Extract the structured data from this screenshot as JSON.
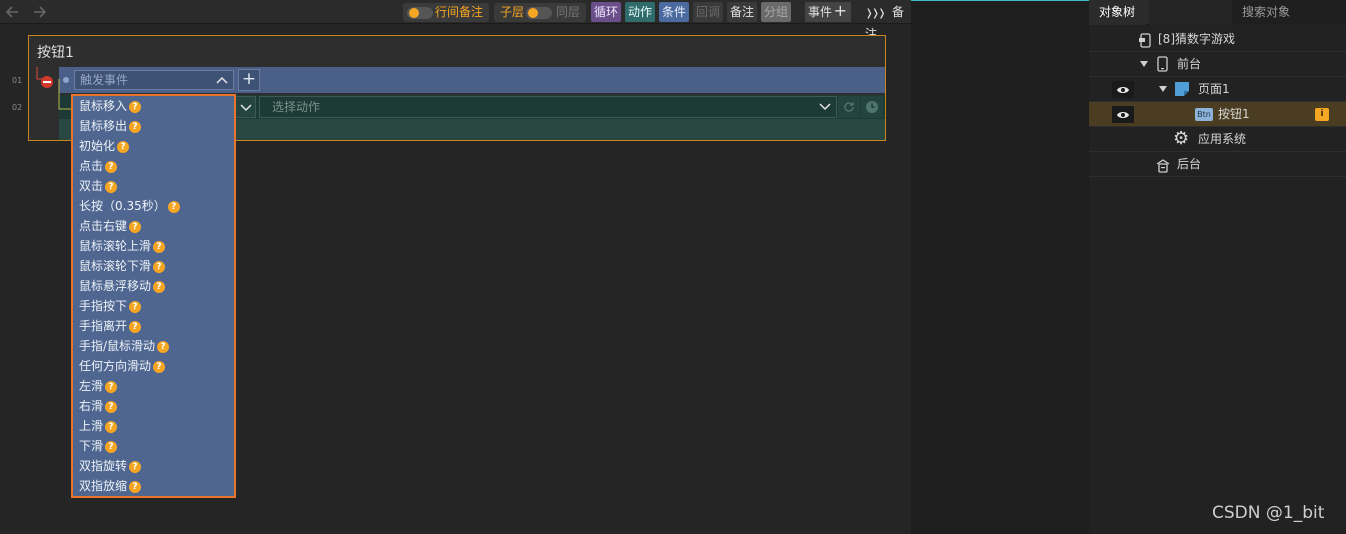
{
  "toolbar": {
    "back_icon": "arrow-left-icon",
    "forward_icon": "arrow-right-icon",
    "inline_note_label": "行间备注",
    "child_layer_label": "子层",
    "same_layer_label": "同层",
    "loop_label": "循环",
    "action_label": "动作",
    "condition_label": "条件",
    "callback_label": "回调",
    "note_label": "备注",
    "group_label": "分组",
    "event_label": "事件",
    "remark_label": "备注",
    "colors": {
      "accent_orange": "#f5a623",
      "loop": "#6b4f8a",
      "action": "#2f6b6b",
      "condition": "#4a6aa0"
    }
  },
  "editor": {
    "title": "按钮1",
    "line_numbers": [
      "01",
      "02"
    ],
    "trigger_placeholder": "触发事件",
    "action_placeholder": "选择动作"
  },
  "dropdown": {
    "help_icon": "question-icon",
    "items": [
      "鼠标移入",
      "鼠标移出",
      "初始化",
      "点击",
      "双击",
      "长按（0.35秒）",
      "点击右键",
      "鼠标滚轮上滑",
      "鼠标滚轮下滑",
      "鼠标悬浮移动",
      "手指按下",
      "手指离开",
      "手指/鼠标滑动",
      "任何方向滑动",
      "左滑",
      "右滑",
      "上滑",
      "下滑",
      "双指旋转",
      "双指放缩"
    ]
  },
  "object_panel": {
    "tab_tree": "对象树",
    "tab_search": "搜索对象",
    "rows": {
      "project": "[8]猜数字游戏",
      "frontend": "前台",
      "page": "页面1",
      "button": "按钮1",
      "button_badge": "Btn",
      "system": "应用系统",
      "backend": "后台"
    }
  },
  "watermark": "CSDN @1_bit"
}
